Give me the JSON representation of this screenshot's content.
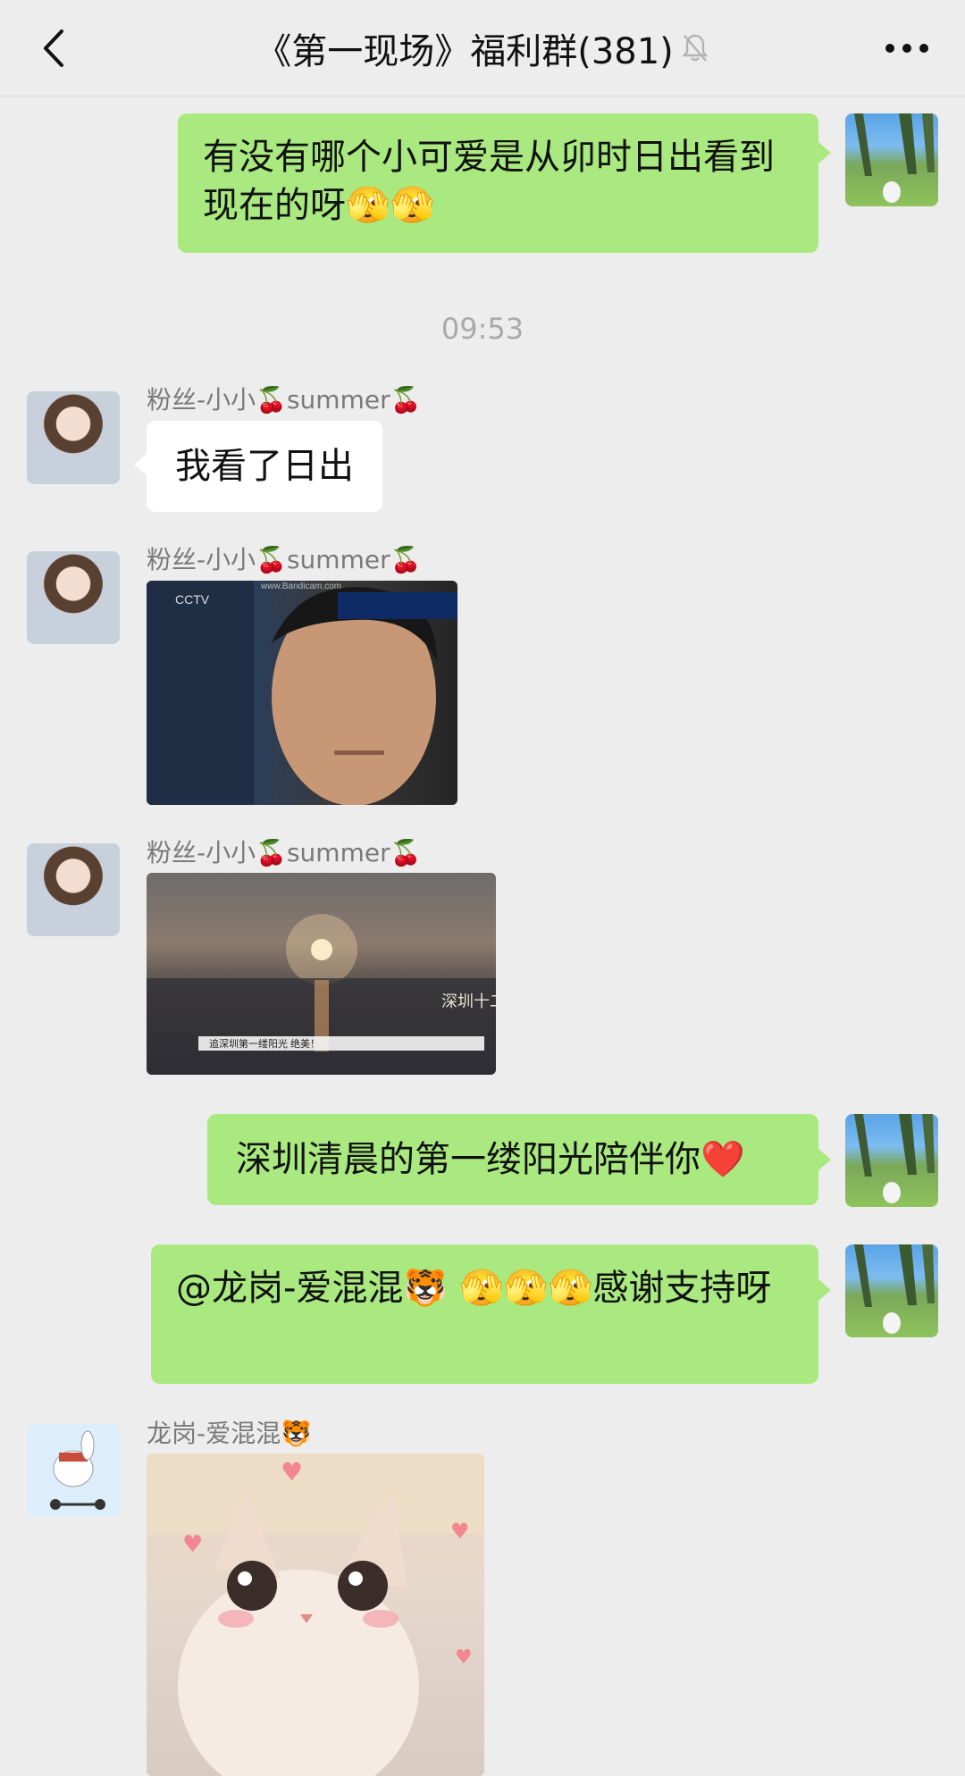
{
  "header": {
    "title": "《第一现场》福利群(381)"
  },
  "messages": {
    "m1": {
      "text": "有没有哪个小可爱是从卯时日出看到现在的呀🫣🫣"
    },
    "timestamp": "09:53",
    "m2": {
      "sender": "粉丝-小小🍒summer🍒",
      "text": "我看了日出"
    },
    "m3": {
      "sender": "粉丝-小小🍒summer🍒",
      "image_text": "www.Bandicam.com"
    },
    "m4": {
      "sender": "粉丝-小小🍒summer🍒",
      "caption": "追深圳第一缕阳光 绝美！",
      "side_text": "深圳十二时辰"
    },
    "m5": {
      "text": "深圳清晨的第一缕阳光陪伴你❤️"
    },
    "m6": {
      "text": "@龙岗-爱混混🐯 🫣🫣🫣感谢支持呀"
    },
    "m7": {
      "sender": "龙岗-爱混混🐯"
    }
  },
  "colors": {
    "bubble_green": "#a9e97f",
    "bubble_white": "#ffffff",
    "background": "#ededed"
  }
}
